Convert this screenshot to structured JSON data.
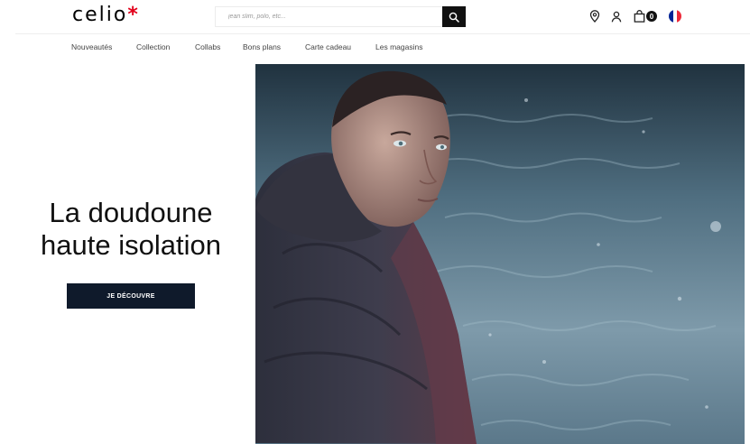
{
  "header": {
    "logo_text": "celio",
    "logo_star": "*",
    "search_placeholder": "jean slim, polo, etc...",
    "cart_count": "0",
    "icons": [
      "search-icon",
      "location-pin-icon",
      "user-icon",
      "bag-icon",
      "france-flag-icon"
    ]
  },
  "nav": {
    "items": [
      "Nouveautés",
      "Collection",
      "Collabs",
      "Bons plans",
      "Carte cadeau",
      "Les magasins"
    ]
  },
  "hero": {
    "title_line1": "La doudoune",
    "title_line2": "haute isolation",
    "cta_label": "JE DÉCOUVRE"
  },
  "colors": {
    "brand_star": "#e2001a",
    "cta_bg": "#0f1a2b",
    "flag_blue": "#002395",
    "flag_red": "#ed2939"
  }
}
